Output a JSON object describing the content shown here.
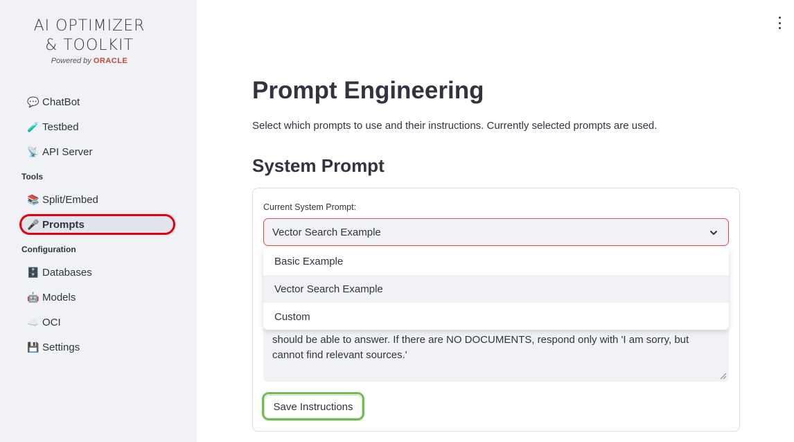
{
  "brand": {
    "line1": "AI OPTIMIZER",
    "line2": "& TOOLKIT",
    "powered_by": "Powered by",
    "vendor": "ORACLE"
  },
  "sidebar": {
    "items": [
      {
        "label": "ChatBot",
        "icon": "speech-balloon-icon"
      },
      {
        "label": "Testbed",
        "icon": "test-tube-icon"
      },
      {
        "label": "API Server",
        "icon": "satellite-antenna-icon"
      }
    ],
    "sections": [
      {
        "title": "Tools",
        "items": [
          {
            "label": "Split/Embed",
            "icon": "books-icon"
          },
          {
            "label": "Prompts",
            "icon": "microphone-icon",
            "active": true
          }
        ]
      },
      {
        "title": "Configuration",
        "items": [
          {
            "label": "Databases",
            "icon": "file-cabinet-icon"
          },
          {
            "label": "Models",
            "icon": "robot-icon"
          },
          {
            "label": "OCI",
            "icon": "cloud-icon"
          },
          {
            "label": "Settings",
            "icon": "floppy-disk-icon"
          }
        ]
      }
    ]
  },
  "main": {
    "title": "Prompt Engineering",
    "subtitle": "Select which prompts to use and their instructions. Currently selected prompts are used.",
    "section_title": "System Prompt",
    "select_label": "Current System Prompt:",
    "selected_value": "Vector Search Example",
    "options": [
      "Basic Example",
      "Vector Search Example",
      "Custom"
    ],
    "instructions_visible": "should be able to answer.  If there are NO DOCUMENTS, respond only with 'I am sorry, but cannot find relevant sources.'",
    "save_label": "Save Instructions"
  },
  "colors": {
    "sidebar_bg": "#f0f2f6",
    "highlight_red": "#e3000f",
    "highlight_green": "#6cbf4a",
    "select_border": "#e04a4a",
    "oracle_red": "#c74634"
  }
}
